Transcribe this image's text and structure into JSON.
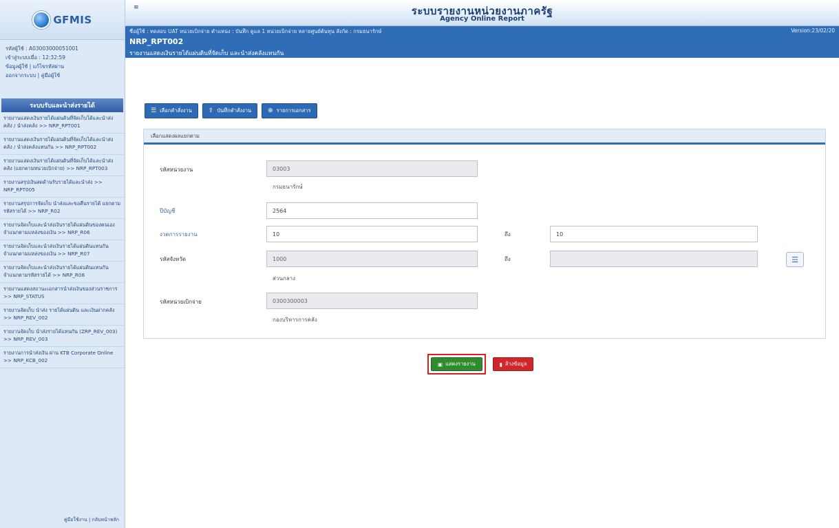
{
  "app": {
    "logo_text": "GFMIS",
    "title_th": "ระบบรายงานหน่วยงานภาครัฐ",
    "title_en": "Agency Online Report",
    "toggle": "≡"
  },
  "user": {
    "user_id": "รหัสผู้ใช้ : A03003000051001",
    "login_time": "เข้าสู่ระบบเมื่อ : 12:32:59",
    "links": "ข้อมูลผู้ใช้ | แก้ไขรหัสผ่าน",
    "links2": "ออกจากระบบ | คู่มือผู้ใช้"
  },
  "sidebar": {
    "menu_title": "ระบบรับและนำส่งรายได้",
    "items": [
      "รายงานแสดงเงินรายได้แผ่นดินที่จัดเก็บได้และนำส่งคลัง / นำส่งคลัง >> NRP_RPT001",
      "รายงานแสดงเงินรายได้แผ่นดินที่จัดเก็บได้และนำส่งคลัง / นำส่งคลังแทนกัน >> NRP_RPT002",
      "รายงานแสดงเงินรายได้แผ่นดินที่จัดเก็บได้และนำส่งคลัง (แยกตามหน่วยเบิกจ่าย) >> NRP_RPT003",
      "รายงานสรุปเงินสดด้านรับรายได้และนำส่ง >> NRP_RPT005",
      "รายงานสรุปการจัดเก็บ นำส่งและขอคืนรายได้ แยกตามรหัสรายได้ >> NRP_R02",
      "รายงานจัดเก็บและนำส่งเงินรายได้แผ่นดินของตนเอง จำแนกตามแหล่งของเงิน >> NRP_R06",
      "รายงานจัดเก็บและนำส่งเงินรายได้แผ่นดินแทนกัน จำแนกตามแหล่งของเงิน >> NRP_R07",
      "รายงานจัดเก็บและนำส่งเงินรายได้แผ่นดินแทนกัน จำแนกตามรหัสรายได้ >> NRP_R08",
      "รายงานแสดงสถานะเอกสารนำส่งเงินของส่วนราชการ >> NRP_STATUS",
      "รายงานจัดเก็บ นำส่ง รายได้แผ่นดิน และเงินฝากคลัง >> NRP_REV_002",
      "รายงานจัดเก็บ นำส่งรายได้แทนกัน (ZRP_REV_003) >> NRP_REV_003",
      "รายงานการนำส่งเงิน ผ่าน KTB Corporate Online >> NRP_KCB_002"
    ],
    "footer": "คู่มือใช้งาน | กลับหน้าหลัก"
  },
  "userbar": {
    "line1": "ชื่อผู้ใช้ : ทดสอบ UAT หน่วยเบิกจ่าย   ตำแหน่ง : บันทึก ดูแล 1 หน่วยเบิกจ่าย หลายศูนย์ต้นทุน   สังกัด : กรมธนารักษ์",
    "version": "Version:23/02/20",
    "report_code": "NRP_RPT002",
    "report_desc": "รายงานแสดงเงินรายได้แผ่นดินที่จัดเก็บ และนำส่งคลังแทนกัน"
  },
  "toolbar": {
    "select_cmd": "เลือกคำสั่งงาน",
    "save_cmd": "บันทึกคำสั่งงาน",
    "doc_list": "รายการเอกสาร"
  },
  "panel": {
    "header": "เลือกแสดงผลแยกตาม"
  },
  "form": {
    "agency_label": "รหัสหน่วยงาน",
    "agency_value": "03003",
    "agency_name": "กรมธนารักษ์",
    "year_label": "ปีบัญชี",
    "year_value": "2564",
    "period_label": "งวดการรายงาน",
    "period_from": "10",
    "to_label1": "ถึง",
    "period_to": "10",
    "province_label": "รหัสจังหวัด",
    "province_value": "1000",
    "to_label2": "ถึง",
    "province_to": "",
    "province_name": "ส่วนกลาง",
    "disb_label": "รหัสหน่วยเบิกจ่าย",
    "disb_value": "0300300003",
    "disb_name": "กองบริหารการคลัง"
  },
  "actions": {
    "report_btn": "แสดงรายงาน",
    "clear_btn": "ล้างข้อมูล"
  }
}
